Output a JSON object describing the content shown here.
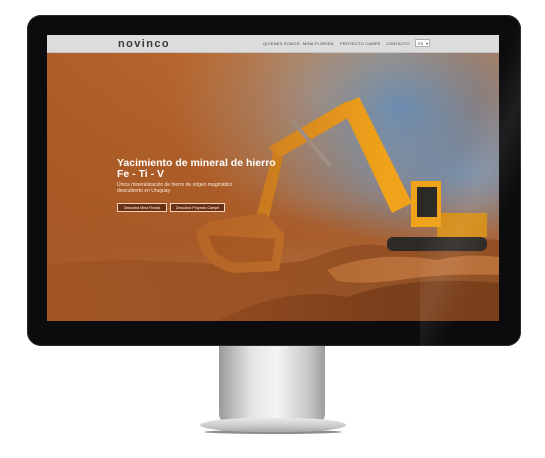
{
  "navbar": {
    "logo": "novinco",
    "links": [
      {
        "label": "QUIENES SOMOS"
      },
      {
        "label": "MINA FLORIDA"
      },
      {
        "label": "PROYECTO CAMPÉ"
      },
      {
        "label": "CONTACTO"
      }
    ],
    "language": "ES"
  },
  "hero": {
    "title_line1": "Yacimiento de mineral de hierro",
    "title_line2": "Fe - Ti - V",
    "subtitle": "Única mineralización de hierro de origen magmático descubierto en Uruguay",
    "buttons": [
      {
        "label": "Descubra Mina Florida"
      },
      {
        "label": "Descubra Proyecto Campé"
      }
    ]
  },
  "colors": {
    "button_bg": "#6b2f14",
    "navbar_bg": "#dcdcdc",
    "bezel": "#0c0c0e",
    "hero_tint": "#b86a2e",
    "excavator": "#f0a21a"
  },
  "icons": [
    "camera-icon",
    "chevron-down-icon"
  ]
}
